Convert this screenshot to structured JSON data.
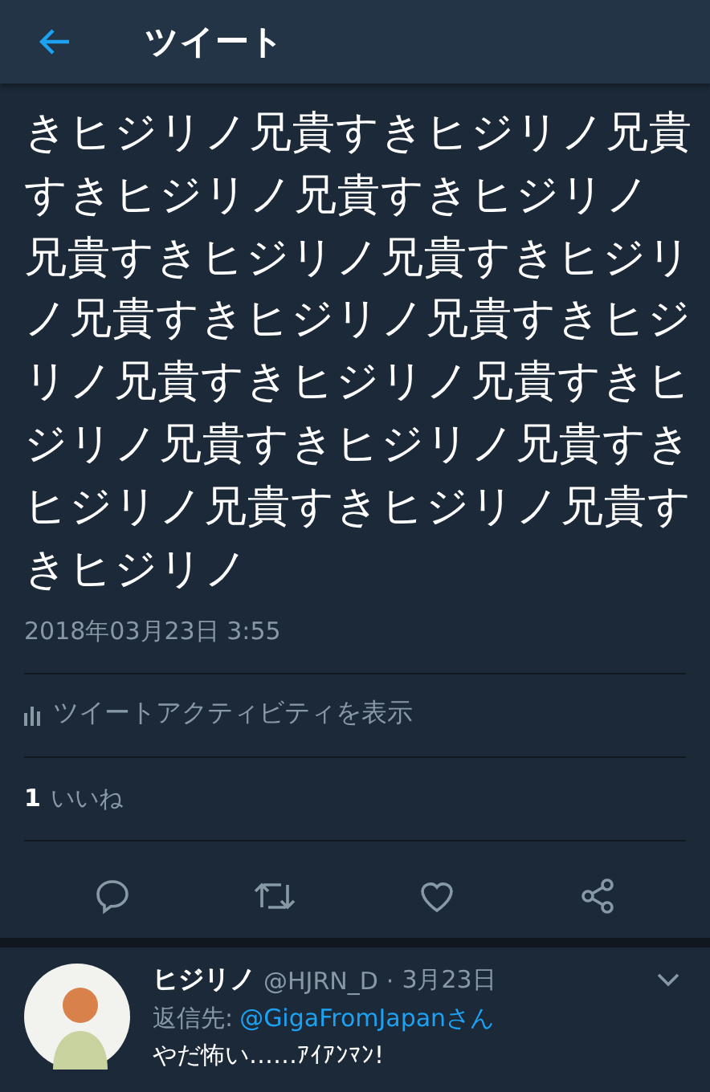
{
  "header": {
    "title": "ツイート"
  },
  "tweet": {
    "lines": [
      "きヒジリノ兄貴すきヒジリノ兄貴",
      "すきヒジリノ兄貴すきヒジリノ",
      "兄貴すきヒジリノ兄貴すきヒジリ",
      "ノ兄貴すきヒジリノ兄貴すきヒジ",
      "リノ兄貴すきヒジリノ兄貴すきヒ",
      "ジリノ兄貴すきヒジリノ兄貴すき",
      "ヒジリノ兄貴すきヒジリノ兄貴す",
      "きヒジリノ"
    ],
    "timestamp": "2018年03月23日 3:55",
    "activity_link": "ツイートアクティビティを表示",
    "likes_count": "1",
    "likes_label": "いいね"
  },
  "reply": {
    "name": "ヒジリノ",
    "handle": "@HJRN_D",
    "separator": "·",
    "date": "3月23日",
    "reply_to_label": "返信先:",
    "reply_to_user": "@GigaFromJapanさん",
    "text": "やだ怖い……ｱｲｱﾝﾏﾝ!"
  }
}
